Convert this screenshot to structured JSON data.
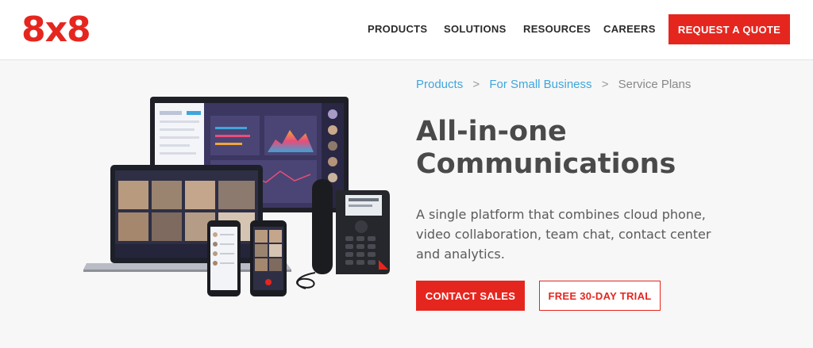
{
  "header": {
    "logo_text": "8x8",
    "nav": [
      "PRODUCTS",
      "SOLUTIONS",
      "RESOURCES",
      "CAREERS"
    ],
    "cta_label": "REQUEST A QUOTE"
  },
  "breadcrumb": {
    "items": [
      "Products",
      "For Small Business"
    ],
    "separator": ">",
    "current": "Service Plans"
  },
  "hero": {
    "title_line1": "All-in-one",
    "title_line2": "Communications",
    "description": "A single platform that combines cloud phone, video collaboration, team chat, contact center and analytics.",
    "primary_button": "CONTACT SALES",
    "secondary_button": "FREE 30-DAY TRIAL",
    "image_icons": [
      "monitor-icon",
      "laptop-icon",
      "smartphone-icon",
      "desk-phone-icon"
    ]
  },
  "colors": {
    "brand_red": "#e5261f",
    "link_blue": "#3fa6dc",
    "text_dark": "#4a4a4a",
    "page_background": "#f7f7f7"
  }
}
